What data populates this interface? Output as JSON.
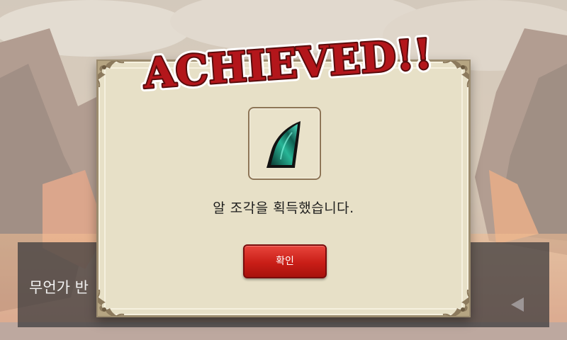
{
  "dialogue": {
    "text": "무언가 반"
  },
  "popup": {
    "title": "ACHIEVED!!",
    "message": "알 조각을 획득했습니다.",
    "confirm_label": "확인",
    "item_icon": "egg-shard-icon"
  },
  "colors": {
    "popup_bg": "#e7e0c7",
    "button_red": "#c91e17",
    "title_red": "#b3161b",
    "shard_teal": "#1f9e84"
  }
}
